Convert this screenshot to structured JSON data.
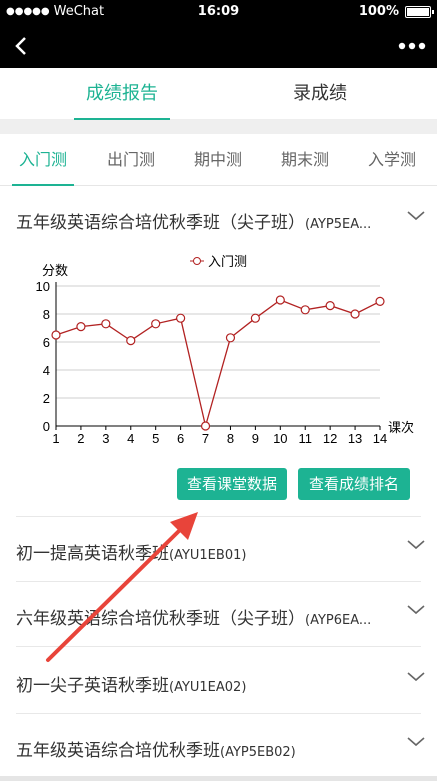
{
  "status": {
    "carrier": "WeChat",
    "time": "16:09",
    "battery": "100%"
  },
  "nav": {
    "back_icon": "chevron-left-icon",
    "more_icon": "more-dots-icon"
  },
  "main_tabs": [
    {
      "label": "成绩报告",
      "active": true
    },
    {
      "label": "录成绩",
      "active": false
    }
  ],
  "sub_tabs": [
    {
      "label": "入门测",
      "active": true
    },
    {
      "label": "出门测",
      "active": false
    },
    {
      "label": "期中测",
      "active": false
    },
    {
      "label": "期末测",
      "active": false
    },
    {
      "label": "入学测",
      "active": false
    }
  ],
  "classes": [
    {
      "name": "五年级英语综合培优秋季班（尖子班）",
      "code": "(AYP5EA..."
    },
    {
      "name": "初一提高英语秋季班",
      "code": "(AYU1EB01)"
    },
    {
      "name": "六年级英语综合培优秋季班（尖子班）",
      "code": "(AYP6EA..."
    },
    {
      "name": "初一尖子英语秋季班",
      "code": "(AYU1EA02)"
    },
    {
      "name": "五年级英语综合培优秋季班",
      "code": "(AYP5EB02)"
    }
  ],
  "chart_data": {
    "type": "line",
    "ylabel": "分数",
    "xlabel": "课次",
    "ylim": [
      0,
      10
    ],
    "yticks": [
      0,
      2,
      4,
      6,
      8,
      10
    ],
    "x": [
      1,
      2,
      3,
      4,
      5,
      6,
      7,
      8,
      9,
      10,
      11,
      12,
      13,
      14
    ],
    "series": [
      {
        "name": "入门测",
        "values": [
          6.5,
          7.1,
          7.3,
          6.1,
          7.3,
          7.7,
          0,
          6.3,
          7.7,
          9.0,
          8.3,
          8.6,
          8.0,
          8.9
        ]
      }
    ],
    "legend": "top",
    "grid": true,
    "color": "#b22222"
  },
  "buttons": {
    "classroom": "查看课堂数据",
    "ranking": "查看成绩排名"
  },
  "colors": {
    "accent": "#1db393",
    "annotation": "#e8443a"
  }
}
